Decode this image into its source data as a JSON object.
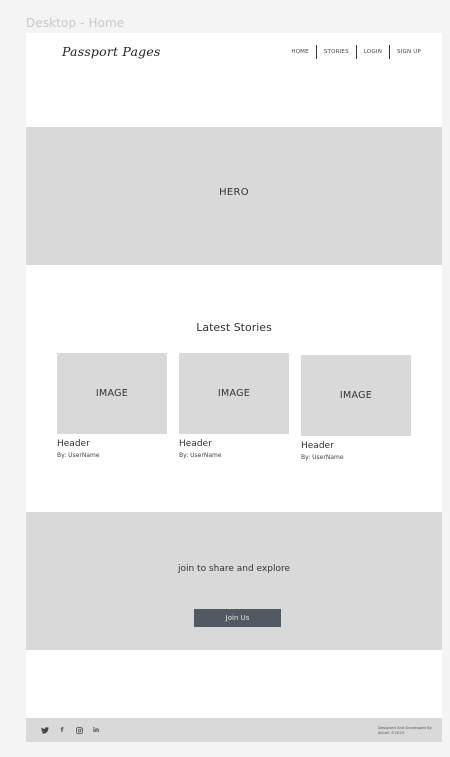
{
  "frame_label": "Desktop - Home",
  "logo": "Passport Pages",
  "nav": {
    "home": "HOME",
    "stories": "STORIES",
    "login": "LOGIN",
    "signup": "SIGN UP"
  },
  "hero": {
    "label": "HERO"
  },
  "latest": {
    "title": "Latest Stories",
    "cards": [
      {
        "image": "IMAGE",
        "header": "Header",
        "author": "By: UserName"
      },
      {
        "image": "IMAGE",
        "header": "Header",
        "author": "By: UserName"
      },
      {
        "image": "IMAGE",
        "header": "Header",
        "author": "By: UserName"
      }
    ]
  },
  "cta": {
    "text": "join to share and explore",
    "button": "Join Us"
  },
  "footer": {
    "social": [
      "twitter-icon",
      "facebook-icon",
      "instagram-icon",
      "linkedin-icon"
    ],
    "credit_line1": "Designed And Developed By",
    "credit_line2": "AtGaS ©2023"
  },
  "colors": {
    "placeholder": "#d9d9d9",
    "button": "#515a63",
    "background": "#f4f4f4"
  }
}
